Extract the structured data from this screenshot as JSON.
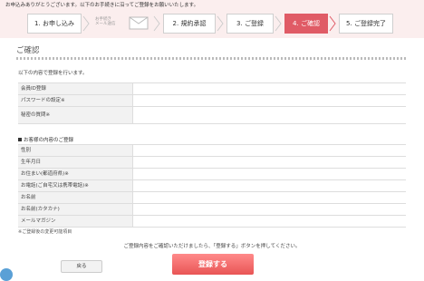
{
  "intro_text": "お申込みありがとうございます。以下のお手続きに沿ってご登録をお願いいたします。",
  "steps": [
    {
      "label": "1. お申し込み"
    },
    {
      "label": "2. 規約承認"
    },
    {
      "label": "3. ご登録"
    },
    {
      "label": "4. ご確認"
    },
    {
      "label": "5. ご登録完了"
    }
  ],
  "mail_note": "お手続き\nメール送信",
  "page_title": "ご確認",
  "lead_text": "以下の内容で登録を行います。",
  "account_rows": [
    {
      "label": "会員ID登録"
    },
    {
      "label": "パスワードの設定※"
    },
    {
      "label": "秘密の質問※"
    }
  ],
  "customer_section_title": "お客様の内容のご登録",
  "customer_rows": [
    {
      "label": "性別"
    },
    {
      "label": "生年月日"
    },
    {
      "label": "お住まい(都道府県)※"
    },
    {
      "label": "お電話(ご自宅又は携帯電話)※"
    },
    {
      "label": "お名前"
    },
    {
      "label": "お名前(カタカナ)"
    },
    {
      "label": "メールマガジン"
    }
  ],
  "footnote": "※ご登録後の変更可能項目",
  "confirm_text": "ご登録内容をご確認いただけましたら、「登録する」ボタンを押してください。",
  "back_label": "戻る",
  "register_label": "登録する",
  "colors": {
    "accent": "#e05b66",
    "header_bg": "#fbeeee"
  }
}
